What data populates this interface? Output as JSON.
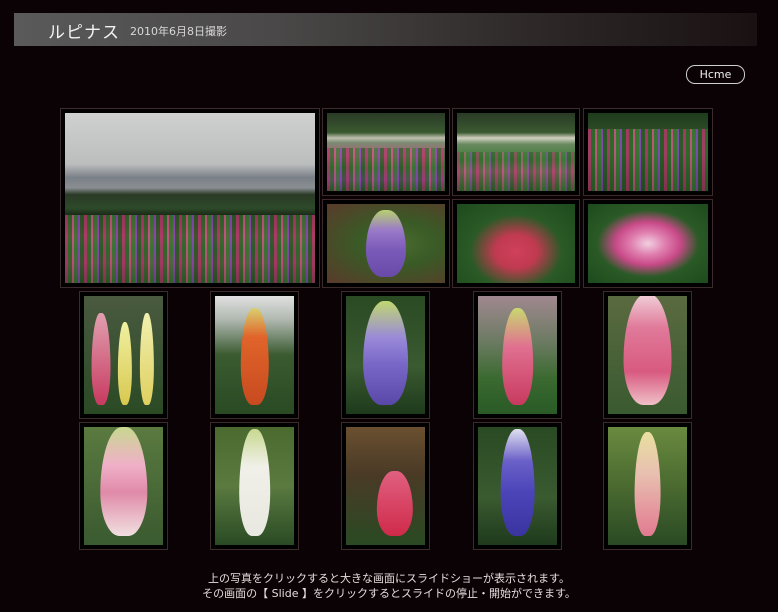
{
  "header": {
    "title": "ルピナス",
    "subtitle": "2010年6月8日撮影"
  },
  "nav": {
    "home_label": "Hcme"
  },
  "colors": {
    "background": "#0a0204",
    "thumb_border": "#3c2a2c",
    "caption_text": "#e4dede"
  },
  "gallery": {
    "top_row": [
      {
        "name": "landscape-photo",
        "subject": "mountain-lupine-field"
      },
      {
        "name": "field-photo-1",
        "subject": "lupine-field"
      },
      {
        "name": "field-photo-2",
        "subject": "lupine-field"
      },
      {
        "name": "field-photo-3",
        "subject": "lupine-field-closeup"
      },
      {
        "name": "flower-photo-purple-cone",
        "subject": "purple-lupine"
      },
      {
        "name": "flower-photo-red-bloom",
        "subject": "red-bloom"
      },
      {
        "name": "flower-photo-pink-bloom",
        "subject": "pink-bloom"
      }
    ],
    "row2": [
      {
        "name": "lupine-pink-yellow",
        "color": "#d04a7a"
      },
      {
        "name": "lupine-orange",
        "color": "#e0642a"
      },
      {
        "name": "lupine-purple-blue",
        "color": "#7a68c8"
      },
      {
        "name": "lupine-pink-cone",
        "color": "#d0507a"
      },
      {
        "name": "lupine-pink-white",
        "color": "#e07a9a"
      }
    ],
    "row3": [
      {
        "name": "lupine-light-pink",
        "color": "#e08aa8"
      },
      {
        "name": "lupine-white",
        "color": "#e8e8e0"
      },
      {
        "name": "lupine-red",
        "color": "#d02a4a"
      },
      {
        "name": "lupine-blue-violet",
        "color": "#4a44b8"
      },
      {
        "name": "lupine-pink-cream",
        "color": "#e27a90"
      }
    ]
  },
  "caption": {
    "line1": "上の写真をクリックすると大きな画面にスライドショーが表示されます。",
    "line2": "その画面の【 Slide 】をクリックするとスライドの停止・開始ができます。"
  }
}
